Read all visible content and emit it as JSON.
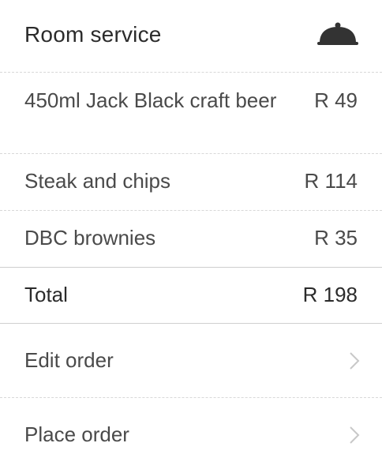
{
  "header": {
    "title": "Room service",
    "icon": "cloche-icon"
  },
  "items": [
    {
      "name": "450ml Jack Black craft beer",
      "price": "R 49"
    },
    {
      "name": "Steak and chips",
      "price": "R 114"
    },
    {
      "name": "DBC brownies",
      "price": "R 35"
    }
  ],
  "total": {
    "label": "Total",
    "value": "R 198"
  },
  "actions": [
    {
      "label": "Edit order",
      "icon": "chevron-right-icon"
    },
    {
      "label": "Place order",
      "icon": "chevron-right-icon"
    }
  ],
  "colors": {
    "text": "#4a4a4a",
    "title": "#2b2b2b",
    "divider": "#d8d8d8",
    "chevron": "#c8c8c8",
    "icon": "#333333"
  }
}
